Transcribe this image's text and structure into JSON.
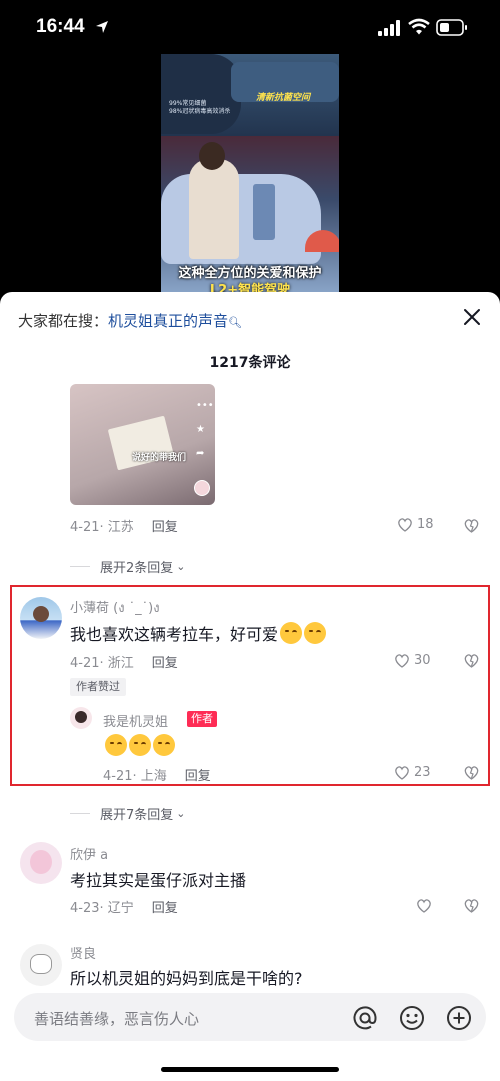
{
  "status_bar": {
    "time": "16:44"
  },
  "video": {
    "overlay_line1": "99%常见细菌",
    "overlay_line2": "98%冠状病毒高效消杀",
    "overlay_title": "清新抗菌空间",
    "caption_line1": "这种全方位的关爱和保护",
    "caption_line2": "L2+智能驾驶"
  },
  "sheet": {
    "search_prefix": "大家都在搜：",
    "search_query": "机灵姐真正的声音",
    "comment_count": "1217条评论",
    "input_placeholder": "善语结善缘，恶言伤人心"
  },
  "thumbnail": {
    "caption": "说好的带我们"
  },
  "comments": [
    {
      "date": "4-21· 江苏",
      "reply": "回复",
      "likes": "18"
    },
    {
      "expand": "展开2条回复",
      "user": "小薄荷 (ง ˙_˙)ง",
      "text": "我也喜欢这辆考拉车，好可爱",
      "date": "4-21· 浙江",
      "reply": "回复",
      "likes": "30",
      "badge": "作者赞过",
      "sub_reply": {
        "user": "我是机灵姐",
        "tag": "作者",
        "date": "4-21· 上海",
        "reply": "回复",
        "likes": "23"
      }
    },
    {
      "expand": "展开7条回复",
      "user": "欣伊 a",
      "text": "考拉其实是蛋仔派对主播",
      "date": "4-23· 辽宁",
      "reply": "回复"
    },
    {
      "user": "贤良",
      "text": "所以机灵姐的妈妈到底是干啥的?"
    }
  ],
  "colors": {
    "accent": "#fe2c55",
    "link": "#1f4f9d",
    "highlight_border": "#e0262e"
  }
}
